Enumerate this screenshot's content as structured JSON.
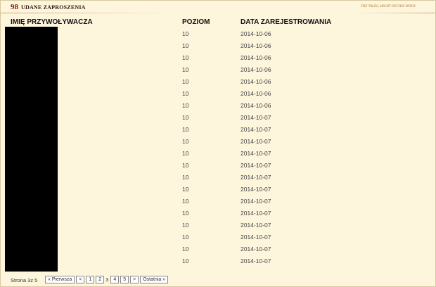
{
  "header": {
    "count": "98",
    "title": "UDANE ZAPROSZENIA",
    "tagline": "THE TALES, MIGHT DECIDE PATHS"
  },
  "table": {
    "columns": [
      "IMIĘ PRZYWOŁYWACZA",
      "POZIOM",
      "DATA ZAREJESTROWANIA"
    ],
    "rows": [
      {
        "level": "10",
        "date": "2014-10-06"
      },
      {
        "level": "10",
        "date": "2014-10-06"
      },
      {
        "level": "10",
        "date": "2014-10-06"
      },
      {
        "level": "10",
        "date": "2014-10-06"
      },
      {
        "level": "10",
        "date": "2014-10-06"
      },
      {
        "level": "10",
        "date": "2014-10-06"
      },
      {
        "level": "10",
        "date": "2014-10-06"
      },
      {
        "level": "10",
        "date": "2014-10-07"
      },
      {
        "level": "10",
        "date": "2014-10-07"
      },
      {
        "level": "10",
        "date": "2014-10-07"
      },
      {
        "level": "10",
        "date": "2014-10-07"
      },
      {
        "level": "10",
        "date": "2014-10-07"
      },
      {
        "level": "10",
        "date": "2014-10-07"
      },
      {
        "level": "10",
        "date": "2014-10-07"
      },
      {
        "level": "10",
        "date": "2014-10-07"
      },
      {
        "level": "10",
        "date": "2014-10-07"
      },
      {
        "level": "10",
        "date": "2014-10-07"
      },
      {
        "level": "10",
        "date": "2014-10-07"
      },
      {
        "level": "10",
        "date": "2014-10-07"
      },
      {
        "level": "10",
        "date": "2014-10-07"
      }
    ]
  },
  "pager": {
    "info": "Strona 3z 5",
    "first": "« Pierwsza",
    "prev": "<",
    "pages": [
      "1",
      "2",
      "3",
      "4",
      "5"
    ],
    "current": "3",
    "next": ">",
    "last": "Ostatnia »"
  }
}
